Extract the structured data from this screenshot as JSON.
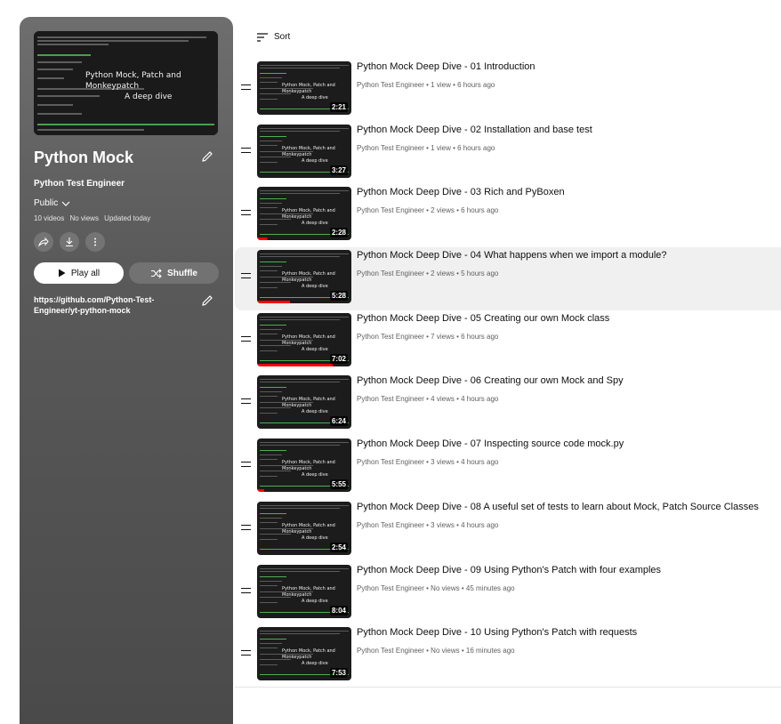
{
  "playlist": {
    "hero_text_line1": "Python Mock, Patch and Monkeypatch",
    "hero_text_line2": "A deep dive",
    "title": "Python Mock",
    "owner": "Python Test Engineer",
    "privacy": "Public",
    "video_count": "10 videos",
    "views": "No views",
    "updated": "Updated today",
    "play_all_label": "Play all",
    "shuffle_label": "Shuffle",
    "description_link": "https://github.com/Python-Test-Engineer/yt-python-mock",
    "colors": {
      "sidebar_top": "#6e6e6e",
      "sidebar_bottom": "#4a4a4a",
      "progress": "#ff0000"
    }
  },
  "sort_label": "Sort",
  "videos": [
    {
      "title": "Python Mock Deep Dive - 01 Introduction",
      "channel": "Python Test Engineer",
      "views": "1 view",
      "age": "6 hours ago",
      "duration": "2:21",
      "watched_fraction": 0
    },
    {
      "title": "Python Mock Deep Dive - 02 Installation and base test",
      "channel": "Python Test Engineer",
      "views": "1 view",
      "age": "6 hours ago",
      "duration": "3:27",
      "watched_fraction": 0
    },
    {
      "title": "Python Mock Deep Dive - 03 Rich and PyBoxen",
      "channel": "Python Test Engineer",
      "views": "2 views",
      "age": "6 hours ago",
      "duration": "2:28",
      "watched_fraction": 0.1
    },
    {
      "title": "Python Mock Deep Dive - 04 What happens when we import a module?",
      "channel": "Python Test Engineer",
      "views": "2 views",
      "age": "5 hours ago",
      "duration": "5:28",
      "watched_fraction": 0.35
    },
    {
      "title": "Python Mock Deep Dive - 05 Creating our own Mock class",
      "channel": "Python Test Engineer",
      "views": "7 views",
      "age": "6 hours ago",
      "duration": "7:02",
      "watched_fraction": 0.8
    },
    {
      "title": "Python Mock Deep Dive - 06 Creating our own Mock and Spy",
      "channel": "Python Test Engineer",
      "views": "4 views",
      "age": "4 hours ago",
      "duration": "6:24",
      "watched_fraction": 0
    },
    {
      "title": "Python Mock Deep Dive - 07 Inspecting source code mock.py",
      "channel": "Python Test Engineer",
      "views": "3 views",
      "age": "4 hours ago",
      "duration": "5:55",
      "watched_fraction": 0.08
    },
    {
      "title": "Python Mock Deep Dive - 08 A useful set of tests to learn about Mock, Patch Source Classes",
      "channel": "Python Test Engineer",
      "views": "3 views",
      "age": "4 hours ago",
      "duration": "2:54",
      "watched_fraction": 0
    },
    {
      "title": "Python Mock Deep Dive - 09 Using Python's Patch with four examples",
      "channel": "Python Test Engineer",
      "views": "No views",
      "age": "45 minutes ago",
      "duration": "8:04",
      "watched_fraction": 0
    },
    {
      "title": "Python Mock Deep Dive - 10 Using Python's Patch with requests",
      "channel": "Python Test Engineer",
      "views": "No views",
      "age": "16 minutes ago",
      "duration": "7:53",
      "watched_fraction": 0
    }
  ]
}
